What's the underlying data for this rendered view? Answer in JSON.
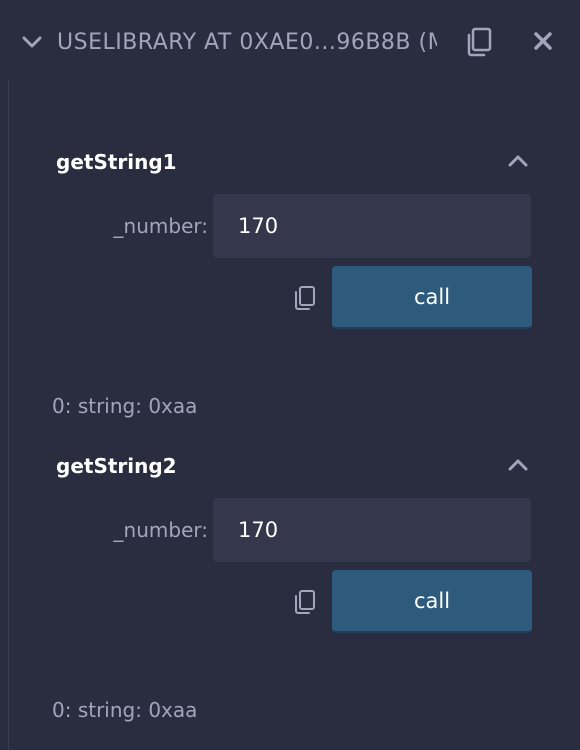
{
  "header": {
    "title": "USELIBRARY AT 0XAE0...96B8B (M",
    "icons": {
      "collapse": "chevron-down-icon",
      "copy": "copy-icon",
      "close": "close-icon"
    }
  },
  "functions": [
    {
      "name": "getString1",
      "param_label": "_number:",
      "param_value": "170",
      "call_label": "call",
      "result": "0: string: 0xaa"
    },
    {
      "name": "getString2",
      "param_label": "_number:",
      "param_value": "170",
      "call_label": "call",
      "result": "0: string: 0xaa"
    }
  ],
  "colors": {
    "background": "#2a2c3f",
    "input_bg": "#35374c",
    "button_bg": "#2e5a7c",
    "muted_text": "#a2a6bd",
    "text": "#ffffff"
  }
}
